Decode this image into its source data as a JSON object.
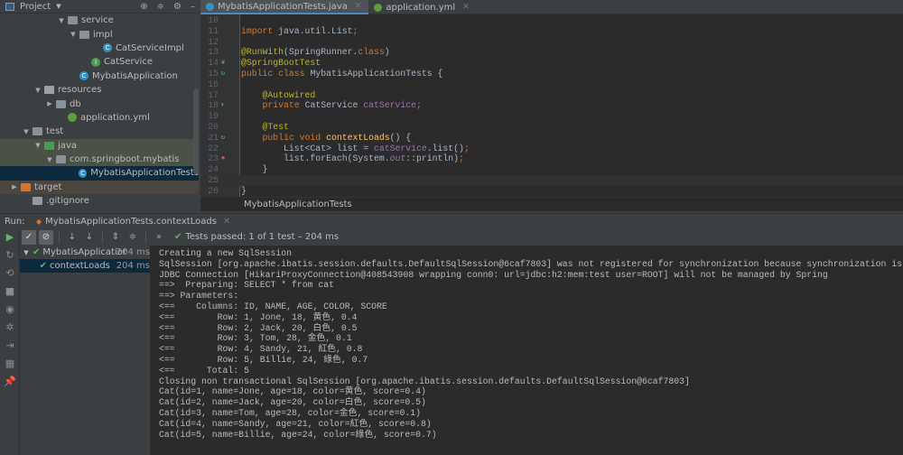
{
  "project_panel": {
    "title": "Project",
    "tools": [
      "crosshair-icon",
      "collapse-icon",
      "gear-icon",
      "minimize-icon"
    ],
    "tree": [
      {
        "label": "service",
        "indent": 5,
        "arrow": "down",
        "icon": "folder",
        "row": ""
      },
      {
        "label": "impl",
        "indent": 6,
        "arrow": "down",
        "icon": "folder",
        "row": ""
      },
      {
        "label": "CatServiceImpl",
        "indent": 8,
        "arrow": "",
        "icon": "class",
        "row": ""
      },
      {
        "label": "CatService",
        "indent": 7,
        "arrow": "",
        "icon": "interface",
        "row": ""
      },
      {
        "label": "MybatisApplication",
        "indent": 6,
        "arrow": "",
        "icon": "class",
        "row": ""
      },
      {
        "label": "resources",
        "indent": 3,
        "arrow": "down",
        "icon": "folder-res",
        "row": ""
      },
      {
        "label": "db",
        "indent": 4,
        "arrow": "right",
        "icon": "folder",
        "row": ""
      },
      {
        "label": "application.yml",
        "indent": 5,
        "arrow": "",
        "icon": "spring",
        "row": ""
      },
      {
        "label": "test",
        "indent": 2,
        "arrow": "down",
        "icon": "folder",
        "row": ""
      },
      {
        "label": "java",
        "indent": 3,
        "arrow": "down",
        "icon": "folder-green",
        "row": "test"
      },
      {
        "label": "com.springboot.mybatis",
        "indent": 4,
        "arrow": "down",
        "icon": "folder",
        "row": "test"
      },
      {
        "label": "MybatisApplicationTests",
        "indent": 6,
        "arrow": "",
        "icon": "class",
        "row": "selected"
      },
      {
        "label": "target",
        "indent": 1,
        "arrow": "right",
        "icon": "folder-orange",
        "row": "target"
      },
      {
        "label": ".gitignore",
        "indent": 2,
        "arrow": "",
        "icon": "file",
        "row": ""
      }
    ]
  },
  "editor": {
    "tabs": [
      {
        "label": "MybatisApplicationTests.java",
        "active": true
      },
      {
        "label": "application.yml",
        "active": false
      }
    ],
    "lines": [
      {
        "n": 10,
        "gutter": "",
        "tokens": []
      },
      {
        "n": 11,
        "gutter": "",
        "tokens": [
          {
            "t": "import ",
            "k": "keyword"
          },
          {
            "t": "java.util.List",
            "k": ""
          },
          {
            "t": ";",
            "k": "keyword"
          }
        ]
      },
      {
        "n": 12,
        "gutter": "",
        "tokens": []
      },
      {
        "n": 13,
        "gutter": "",
        "tokens": [
          {
            "t": "@RunWith",
            "k": "annotation"
          },
          {
            "t": "(SpringRunner.",
            "k": ""
          },
          {
            "t": "class",
            "k": "keyword"
          },
          {
            "t": ")",
            "k": ""
          }
        ]
      },
      {
        "n": 14,
        "gutter": "spring",
        "tokens": [
          {
            "t": "@SpringBootTest",
            "k": "annotation"
          }
        ]
      },
      {
        "n": 15,
        "gutter": "run",
        "tokens": [
          {
            "t": "public class ",
            "k": "keyword"
          },
          {
            "t": "MybatisApplicationTests {",
            "k": ""
          }
        ]
      },
      {
        "n": 16,
        "gutter": "",
        "tokens": []
      },
      {
        "n": 17,
        "gutter": "",
        "tokens": [
          {
            "t": "    @Autowired",
            "k": "annotation"
          }
        ]
      },
      {
        "n": 18,
        "gutter": "bean",
        "tokens": [
          {
            "t": "    private ",
            "k": "keyword"
          },
          {
            "t": "CatService ",
            "k": ""
          },
          {
            "t": "catService",
            "k": "field"
          },
          {
            "t": ";",
            "k": "keyword"
          }
        ]
      },
      {
        "n": 19,
        "gutter": "",
        "tokens": []
      },
      {
        "n": 20,
        "gutter": "",
        "tokens": [
          {
            "t": "    @Test",
            "k": "annotation"
          }
        ]
      },
      {
        "n": 21,
        "gutter": "run",
        "tokens": [
          {
            "t": "    public void ",
            "k": "keyword"
          },
          {
            "t": "contextLoads",
            "k": "method"
          },
          {
            "t": "() {",
            "k": ""
          }
        ]
      },
      {
        "n": 22,
        "gutter": "",
        "tokens": [
          {
            "t": "        List<Cat> list = ",
            "k": ""
          },
          {
            "t": "catService",
            "k": "field"
          },
          {
            "t": ".list()",
            "k": ""
          },
          {
            "t": ";",
            "k": "keyword"
          }
        ]
      },
      {
        "n": 23,
        "gutter": "breakpoint",
        "tokens": [
          {
            "t": "        list.forEach(System.",
            "k": ""
          },
          {
            "t": "out",
            "k": "static"
          },
          {
            "t": "::println)",
            "k": ""
          },
          {
            "t": ";",
            "k": "keyword"
          }
        ]
      },
      {
        "n": 24,
        "gutter": "",
        "tokens": [
          {
            "t": "    }",
            "k": ""
          }
        ]
      },
      {
        "n": 25,
        "gutter": "",
        "tokens": [],
        "current": true
      },
      {
        "n": 26,
        "gutter": "",
        "tokens": [
          {
            "t": "}",
            "k": ""
          }
        ]
      }
    ],
    "breadcrumb": "MybatisApplicationTests"
  },
  "run": {
    "label": "Run:",
    "tab": "MybatisApplicationTests.contextLoads",
    "status": "Tests passed: 1 of 1 test – 204 ms",
    "tree": [
      {
        "label": "MybatisApplicatior",
        "time": "204 ms"
      },
      {
        "label": "contextLoads",
        "time": "204 ms"
      }
    ],
    "console": [
      "Creating a new SqlSession",
      "SqlSession [org.apache.ibatis.session.defaults.DefaultSqlSession@6caf7803] was not registered for synchronization because synchronization is",
      "JDBC Connection [HikariProxyConnection@408543908 wrapping conn0: url=jdbc:h2:mem:test user=ROOT] will not be managed by Spring",
      "==>  Preparing: SELECT * from cat",
      "==> Parameters: ",
      "<==    Columns: ID, NAME, AGE, COLOR, SCORE",
      "<==        Row: 1, Jone, 18, 黄色, 0.4",
      "<==        Row: 2, Jack, 20, 白色, 0.5",
      "<==        Row: 3, Tom, 28, 金色, 0.1",
      "<==        Row: 4, Sandy, 21, 紅色, 0.8",
      "<==        Row: 5, Billie, 24, 綠色, 0.7",
      "<==      Total: 5",
      "Closing non transactional SqlSession [org.apache.ibatis.session.defaults.DefaultSqlSession@6caf7803]",
      "Cat(id=1, name=Jone, age=18, color=黄色, score=0.4)",
      "Cat(id=2, name=Jack, age=20, color=白色, score=0.5)",
      "Cat(id=3, name=Tom, age=28, color=金色, score=0.1)",
      "Cat(id=4, name=Sandy, age=21, color=紅色, score=0.8)",
      "Cat(id=5, name=Billie, age=24, color=綠色, score=0.7)"
    ]
  },
  "colors": {
    "accent": "#4a88c7",
    "pass": "#5fb85f",
    "selection": "#0d293e"
  }
}
